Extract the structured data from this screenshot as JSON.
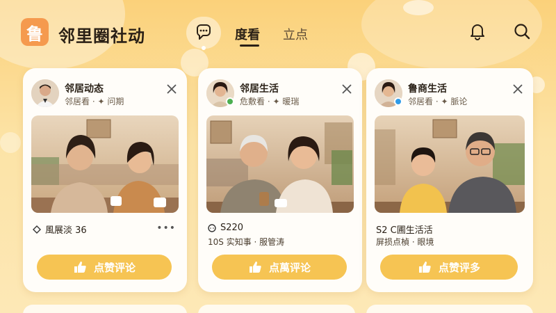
{
  "header": {
    "logo_char": "鲁",
    "app_title": "邻里圈社动",
    "tabs": [
      {
        "label": "度看",
        "active": true
      },
      {
        "label": "立点",
        "active": false
      }
    ],
    "icons": [
      "chat-bubble-icon",
      "bell-icon",
      "search-icon"
    ]
  },
  "cards": [
    {
      "title": "邻居动态",
      "subtitle": "邻居看 · ✦ 问期",
      "badge_color": "",
      "meta_line1": "風展淡 36",
      "meta_line2": "",
      "meta_icon": "diamond-icon",
      "show_more": "•••",
      "action_label": "点赞评论"
    },
    {
      "title": "邻居生活",
      "subtitle": "危敷看 · ✦ 暖瑞",
      "badge_color": "#4caf50",
      "meta_line1": "S220",
      "meta_line2": "10S 实知事 · 服管涛",
      "meta_icon": "chat-bubble-icon",
      "show_more": "",
      "action_label": "点萬评论"
    },
    {
      "title": "鲁商生活",
      "subtitle": "邻居看 · ✦ 脈论",
      "badge_color": "#2f9be8",
      "meta_line1": "S2 C圃生活活",
      "meta_line2": "屏损点楨 · 眼境",
      "meta_icon": "",
      "show_more": "",
      "action_label": "点赞评多"
    }
  ],
  "colors": {
    "accent": "#f6c453",
    "logo": "#f59a4e",
    "background": "#fbd98a"
  }
}
